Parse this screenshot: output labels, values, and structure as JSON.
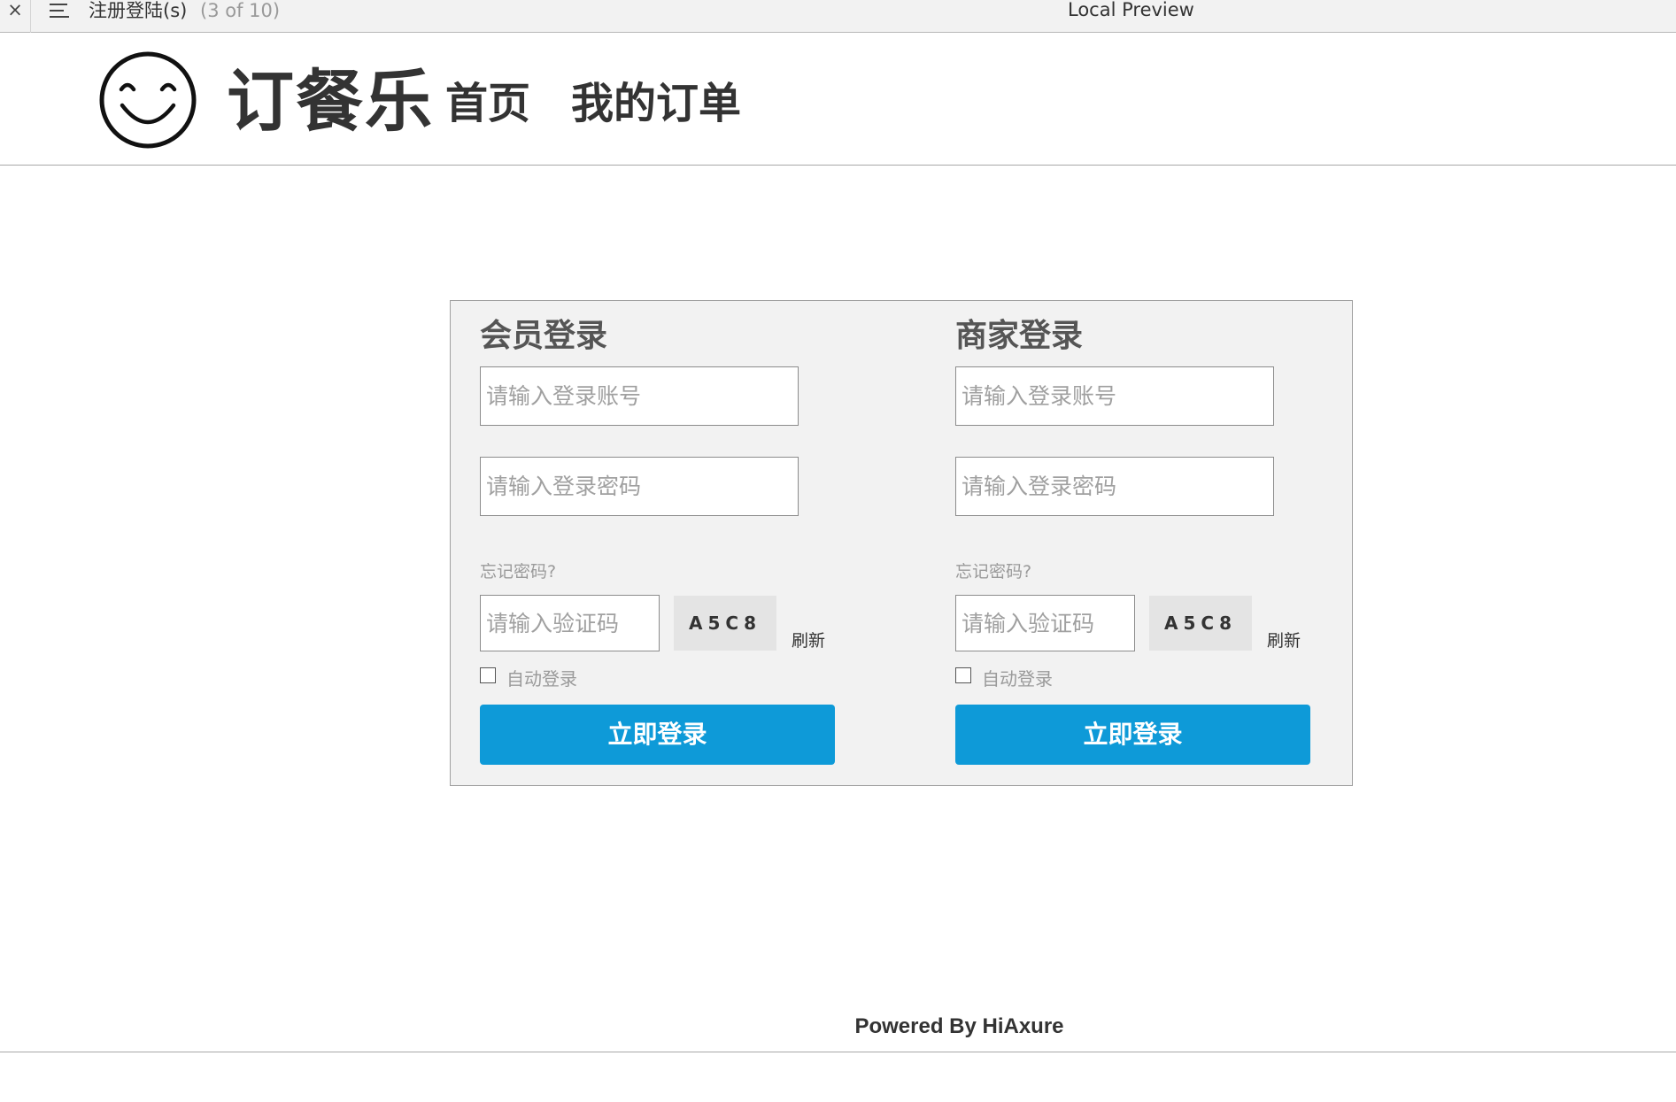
{
  "topbar": {
    "close_glyph": "×",
    "page_name": "注册登陆(s)",
    "page_count": "(3 of 10)",
    "preview_title": "Local Preview"
  },
  "header": {
    "brand": "订餐乐",
    "nav": {
      "home": "首页",
      "orders": "我的订单"
    }
  },
  "member_login": {
    "title": "会员登录",
    "account_placeholder": "请输入登录账号",
    "password_placeholder": "请输入登录密码",
    "forgot": "忘记密码?",
    "captcha_placeholder": "请输入验证码",
    "captcha_code": "A5C8",
    "refresh": "刷新",
    "auto_login": "自动登录",
    "auto_login_checked": false,
    "submit": "立即登录"
  },
  "merchant_login": {
    "title": "商家登录",
    "account_placeholder": "请输入登录账号",
    "password_placeholder": "请输入登录密码",
    "forgot": "忘记密码?",
    "captcha_placeholder": "请输入验证码",
    "captcha_code": "A5C8",
    "refresh": "刷新",
    "auto_login": "自动登录",
    "auto_login_checked": false,
    "submit": "立即登录"
  },
  "footer": {
    "text": "Powered By HiAxure"
  },
  "icons": {
    "logo": "smiley-face-icon",
    "menu": "hamburger-menu-icon",
    "close": "close-icon"
  },
  "colors": {
    "primary_button": "#0e9ad8",
    "panel_background": "#f2f2f2",
    "toolbar_background": "#f2f2f2"
  }
}
